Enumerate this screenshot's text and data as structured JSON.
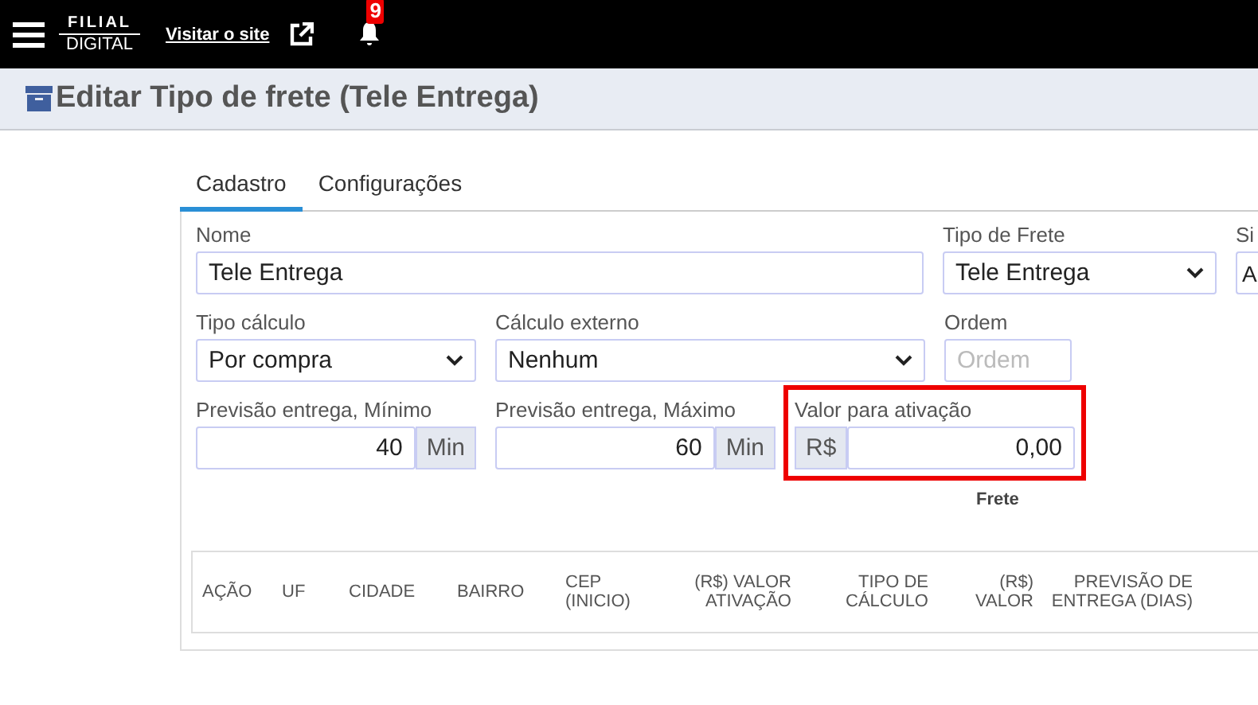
{
  "topbar": {
    "logo": [
      "FILIAL",
      "DIGITAL"
    ],
    "link": "Visitar o site",
    "badge": "9"
  },
  "header": {
    "title": "Editar Tipo de frete (Tele Entrega)"
  },
  "tabs": [
    {
      "label": "Cadastro",
      "selected": true
    },
    {
      "label": "Configurações",
      "selected": false
    }
  ],
  "form_rows": [
    [
      {
        "kind": "text",
        "label": "Nome",
        "value": "Tele Entrega"
      },
      {
        "kind": "select",
        "label": "Tipo de Frete",
        "value": "Tele Entrega"
      },
      {
        "kind": "select",
        "label": "Si",
        "value": "A"
      }
    ],
    [
      {
        "kind": "select",
        "label": "Tipo cálculo",
        "value": "Por compra"
      },
      {
        "kind": "select",
        "label": "Cálculo externo",
        "value": "Nenhum"
      },
      {
        "kind": "text",
        "label": "Ordem",
        "placeholder": "Ordem"
      }
    ],
    [
      {
        "kind": "suffix",
        "label": "Previsão entrega, Mínimo",
        "value": "40",
        "addon": "Min"
      },
      {
        "kind": "suffix",
        "label": "Previsão entrega, Máximo",
        "value": "60",
        "addon": "Min"
      },
      {
        "kind": "prefix",
        "label": "Valor para ativação",
        "value": "0,00",
        "addon": "R$",
        "highlighted": true
      }
    ]
  ],
  "section_label": "Frete",
  "table": {
    "columns": [
      "AÇÃO",
      "UF",
      "CIDADE",
      "BAIRRO",
      "CEP (INICIO)",
      "(R$) VALOR ATIVAÇÃO",
      "TIPO DE CÁLCULO",
      "(R$) VALOR",
      "PREVISÃO DE ENTREGA (DIAS)"
    ]
  }
}
